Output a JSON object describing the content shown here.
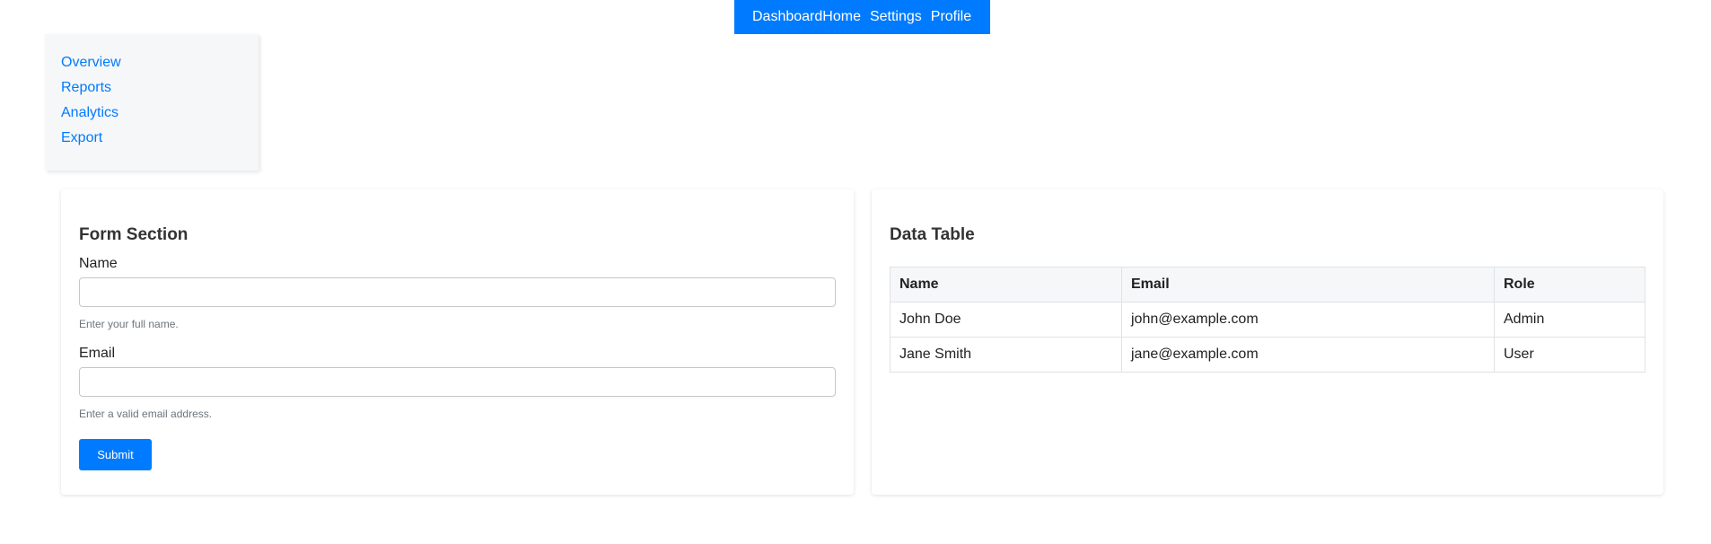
{
  "topnav": {
    "brand": "Dashboard",
    "links": [
      "Home",
      "Settings",
      "Profile"
    ]
  },
  "sidebar": {
    "items": [
      "Overview",
      "Reports",
      "Analytics",
      "Export"
    ]
  },
  "form_section": {
    "title": "Form Section",
    "name_label": "Name",
    "name_value": "",
    "name_help": "Enter your full name.",
    "email_label": "Email",
    "email_value": "",
    "email_help": "Enter a valid email address.",
    "submit_label": "Submit"
  },
  "data_table": {
    "title": "Data Table",
    "headers": [
      "Name",
      "Email",
      "Role"
    ],
    "rows": [
      [
        "John Doe",
        "john@example.com",
        "Admin"
      ],
      [
        "Jane Smith",
        "jane@example.com",
        "User"
      ]
    ]
  },
  "colors": {
    "accent": "#007bff",
    "sidebar_bg": "#f6f7f9"
  }
}
